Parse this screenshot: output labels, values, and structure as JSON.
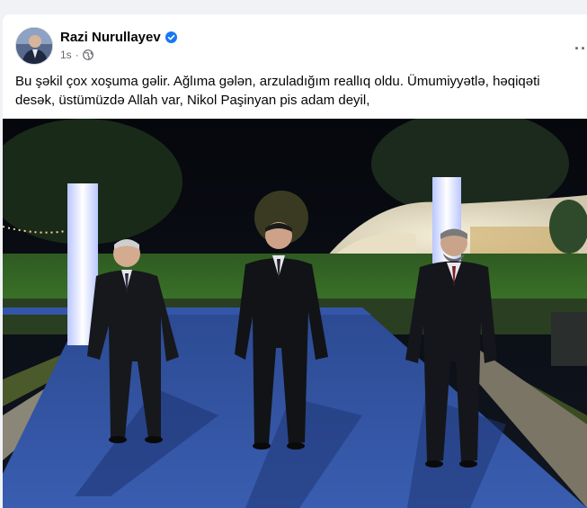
{
  "post": {
    "author_name": "Razi Nurullayev",
    "timestamp": "1s",
    "text": "Bu şəkil çox xoşuma gəlir. Ağlıma gələn, arzuladığım reallıq oldu. Ümumiyyətlə, həqiqəti desək, üstümüzdə Allah var, Nikol Paşinyan pis adam deyil,",
    "more_label": "···"
  },
  "icons": {
    "verified": "verified-badge-icon",
    "audience": "globe-icon",
    "more": "more-options-icon"
  },
  "colors": {
    "verified_blue": "#1877f2",
    "meta_gray": "#65676b",
    "text": "#050505",
    "carpet": "#2e4ea0"
  }
}
